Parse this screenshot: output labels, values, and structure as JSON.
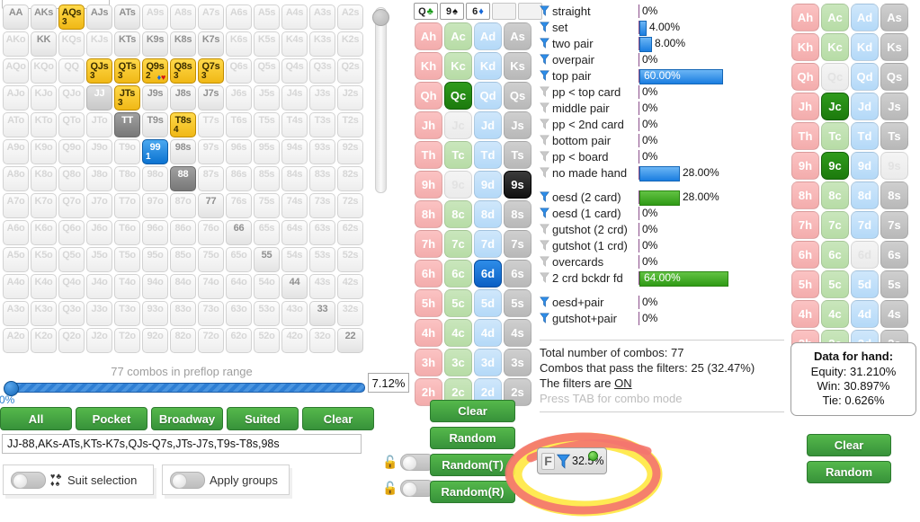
{
  "colors": {
    "accent_green": "#3d9a3d",
    "accent_blue": "#1a7de0",
    "select_yellow": "#f0b816",
    "highlight_red": "#f4746f",
    "highlight_yellow": "#ffe94a"
  },
  "matrix": {
    "rows": [
      [
        {
          "label": "AA",
          "state": "mid"
        },
        {
          "label": "AKs",
          "state": "mid"
        },
        {
          "label": "AQs",
          "state": "sel-y",
          "count": "3"
        },
        {
          "label": "AJs",
          "state": "mid"
        },
        {
          "label": "ATs",
          "state": "mid"
        },
        {
          "label": "A9s",
          "state": "dim"
        },
        {
          "label": "A8s",
          "state": "dim"
        },
        {
          "label": "A7s",
          "state": "dim"
        },
        {
          "label": "A6s",
          "state": "dim"
        },
        {
          "label": "A5s",
          "state": "dim"
        },
        {
          "label": "A4s",
          "state": "dim"
        },
        {
          "label": "A3s",
          "state": "dim"
        },
        {
          "label": "A2s",
          "state": "dim"
        }
      ],
      [
        {
          "label": "AKo",
          "state": "dim"
        },
        {
          "label": "KK",
          "state": "mid"
        },
        {
          "label": "KQs",
          "state": "dim"
        },
        {
          "label": "KJs",
          "state": "dim"
        },
        {
          "label": "KTs",
          "state": "mid"
        },
        {
          "label": "K9s",
          "state": "mid"
        },
        {
          "label": "K8s",
          "state": "mid"
        },
        {
          "label": "K7s",
          "state": "mid"
        },
        {
          "label": "K6s",
          "state": "dim"
        },
        {
          "label": "K5s",
          "state": "dim"
        },
        {
          "label": "K4s",
          "state": "dim"
        },
        {
          "label": "K3s",
          "state": "dim"
        },
        {
          "label": "K2s",
          "state": "dim"
        }
      ],
      [
        {
          "label": "AQo",
          "state": "dim"
        },
        {
          "label": "KQo",
          "state": "dim"
        },
        {
          "label": "QQ",
          "state": "dim"
        },
        {
          "label": "QJs",
          "state": "sel-y",
          "count": "3"
        },
        {
          "label": "QTs",
          "state": "sel-y",
          "count": "3"
        },
        {
          "label": "Q9s",
          "state": "sel-y",
          "count": "2",
          "suits": "♦♥"
        },
        {
          "label": "Q8s",
          "state": "sel-y",
          "count": "3"
        },
        {
          "label": "Q7s",
          "state": "sel-y",
          "count": "3"
        },
        {
          "label": "Q6s",
          "state": "dim"
        },
        {
          "label": "Q5s",
          "state": "dim"
        },
        {
          "label": "Q4s",
          "state": "dim"
        },
        {
          "label": "Q3s",
          "state": "dim"
        },
        {
          "label": "Q2s",
          "state": "dim"
        }
      ],
      [
        {
          "label": "AJo",
          "state": "dim"
        },
        {
          "label": "KJo",
          "state": "dim"
        },
        {
          "label": "QJo",
          "state": "dim"
        },
        {
          "label": "JJ",
          "state": "sel-lg"
        },
        {
          "label": "JTs",
          "state": "sel-y",
          "count": "3"
        },
        {
          "label": "J9s",
          "state": "mid"
        },
        {
          "label": "J8s",
          "state": "mid"
        },
        {
          "label": "J7s",
          "state": "mid"
        },
        {
          "label": "J6s",
          "state": "dim"
        },
        {
          "label": "J5s",
          "state": "dim"
        },
        {
          "label": "J4s",
          "state": "dim"
        },
        {
          "label": "J3s",
          "state": "dim"
        },
        {
          "label": "J2s",
          "state": "dim"
        }
      ],
      [
        {
          "label": "ATo",
          "state": "dim"
        },
        {
          "label": "KTo",
          "state": "dim"
        },
        {
          "label": "QTo",
          "state": "dim"
        },
        {
          "label": "JTo",
          "state": "dim"
        },
        {
          "label": "TT",
          "state": "sel-dg"
        },
        {
          "label": "T9s",
          "state": "mid"
        },
        {
          "label": "T8s",
          "state": "sel-y",
          "count": "4"
        },
        {
          "label": "T7s",
          "state": "dim"
        },
        {
          "label": "T6s",
          "state": "dim"
        },
        {
          "label": "T5s",
          "state": "dim"
        },
        {
          "label": "T4s",
          "state": "dim"
        },
        {
          "label": "T3s",
          "state": "dim"
        },
        {
          "label": "T2s",
          "state": "dim"
        }
      ],
      [
        {
          "label": "A9o",
          "state": "dim"
        },
        {
          "label": "K9o",
          "state": "dim"
        },
        {
          "label": "Q9o",
          "state": "dim"
        },
        {
          "label": "J9o",
          "state": "dim"
        },
        {
          "label": "T9o",
          "state": "dim"
        },
        {
          "label": "99",
          "state": "sel-b",
          "count": "1"
        },
        {
          "label": "98s",
          "state": "mid"
        },
        {
          "label": "97s",
          "state": "dim"
        },
        {
          "label": "96s",
          "state": "dim"
        },
        {
          "label": "95s",
          "state": "dim"
        },
        {
          "label": "94s",
          "state": "dim"
        },
        {
          "label": "93s",
          "state": "dim"
        },
        {
          "label": "92s",
          "state": "dim"
        }
      ],
      [
        {
          "label": "A8o",
          "state": "dim"
        },
        {
          "label": "K8o",
          "state": "dim"
        },
        {
          "label": "Q8o",
          "state": "dim"
        },
        {
          "label": "J8o",
          "state": "dim"
        },
        {
          "label": "T8o",
          "state": "dim"
        },
        {
          "label": "98o",
          "state": "dim"
        },
        {
          "label": "88",
          "state": "sel-dg"
        },
        {
          "label": "87s",
          "state": "dim"
        },
        {
          "label": "86s",
          "state": "dim"
        },
        {
          "label": "85s",
          "state": "dim"
        },
        {
          "label": "84s",
          "state": "dim"
        },
        {
          "label": "83s",
          "state": "dim"
        },
        {
          "label": "82s",
          "state": "dim"
        }
      ],
      [
        {
          "label": "A7o",
          "state": "dim"
        },
        {
          "label": "K7o",
          "state": "dim"
        },
        {
          "label": "Q7o",
          "state": "dim"
        },
        {
          "label": "J7o",
          "state": "dim"
        },
        {
          "label": "T7o",
          "state": "dim"
        },
        {
          "label": "97o",
          "state": "dim"
        },
        {
          "label": "87o",
          "state": "dim"
        },
        {
          "label": "77",
          "state": "mid"
        },
        {
          "label": "76s",
          "state": "dim"
        },
        {
          "label": "75s",
          "state": "dim"
        },
        {
          "label": "74s",
          "state": "dim"
        },
        {
          "label": "73s",
          "state": "dim"
        },
        {
          "label": "72s",
          "state": "dim"
        }
      ],
      [
        {
          "label": "A6o",
          "state": "dim"
        },
        {
          "label": "K6o",
          "state": "dim"
        },
        {
          "label": "Q6o",
          "state": "dim"
        },
        {
          "label": "J6o",
          "state": "dim"
        },
        {
          "label": "T6o",
          "state": "dim"
        },
        {
          "label": "96o",
          "state": "dim"
        },
        {
          "label": "86o",
          "state": "dim"
        },
        {
          "label": "76o",
          "state": "dim"
        },
        {
          "label": "66",
          "state": "mid"
        },
        {
          "label": "65s",
          "state": "dim"
        },
        {
          "label": "64s",
          "state": "dim"
        },
        {
          "label": "63s",
          "state": "dim"
        },
        {
          "label": "62s",
          "state": "dim"
        }
      ],
      [
        {
          "label": "A5o",
          "state": "dim"
        },
        {
          "label": "K5o",
          "state": "dim"
        },
        {
          "label": "Q5o",
          "state": "dim"
        },
        {
          "label": "J5o",
          "state": "dim"
        },
        {
          "label": "T5o",
          "state": "dim"
        },
        {
          "label": "95o",
          "state": "dim"
        },
        {
          "label": "85o",
          "state": "dim"
        },
        {
          "label": "75o",
          "state": "dim"
        },
        {
          "label": "65o",
          "state": "dim"
        },
        {
          "label": "55",
          "state": "mid"
        },
        {
          "label": "54s",
          "state": "dim"
        },
        {
          "label": "53s",
          "state": "dim"
        },
        {
          "label": "52s",
          "state": "dim"
        }
      ],
      [
        {
          "label": "A4o",
          "state": "dim"
        },
        {
          "label": "K4o",
          "state": "dim"
        },
        {
          "label": "Q4o",
          "state": "dim"
        },
        {
          "label": "J4o",
          "state": "dim"
        },
        {
          "label": "T4o",
          "state": "dim"
        },
        {
          "label": "94o",
          "state": "dim"
        },
        {
          "label": "84o",
          "state": "dim"
        },
        {
          "label": "74o",
          "state": "dim"
        },
        {
          "label": "64o",
          "state": "dim"
        },
        {
          "label": "54o",
          "state": "dim"
        },
        {
          "label": "44",
          "state": "mid"
        },
        {
          "label": "43s",
          "state": "dim"
        },
        {
          "label": "42s",
          "state": "dim"
        }
      ],
      [
        {
          "label": "A3o",
          "state": "dim"
        },
        {
          "label": "K3o",
          "state": "dim"
        },
        {
          "label": "Q3o",
          "state": "dim"
        },
        {
          "label": "J3o",
          "state": "dim"
        },
        {
          "label": "T3o",
          "state": "dim"
        },
        {
          "label": "93o",
          "state": "dim"
        },
        {
          "label": "83o",
          "state": "dim"
        },
        {
          "label": "73o",
          "state": "dim"
        },
        {
          "label": "63o",
          "state": "dim"
        },
        {
          "label": "53o",
          "state": "dim"
        },
        {
          "label": "43o",
          "state": "dim"
        },
        {
          "label": "33",
          "state": "mid"
        },
        {
          "label": "32s",
          "state": "dim"
        }
      ],
      [
        {
          "label": "A2o",
          "state": "dim"
        },
        {
          "label": "K2o",
          "state": "dim"
        },
        {
          "label": "Q2o",
          "state": "dim"
        },
        {
          "label": "J2o",
          "state": "dim"
        },
        {
          "label": "T2o",
          "state": "dim"
        },
        {
          "label": "92o",
          "state": "dim"
        },
        {
          "label": "82o",
          "state": "dim"
        },
        {
          "label": "72o",
          "state": "dim"
        },
        {
          "label": "62o",
          "state": "dim"
        },
        {
          "label": "52o",
          "state": "dim"
        },
        {
          "label": "42o",
          "state": "dim"
        },
        {
          "label": "32o",
          "state": "dim"
        },
        {
          "label": "22",
          "state": "mid"
        }
      ]
    ]
  },
  "range_slider": {
    "combos_label": "77 combos in preflop range",
    "min_label": "0%",
    "percent_value": "7.12%"
  },
  "range_buttons": [
    {
      "label": "All"
    },
    {
      "label": "Pocket"
    },
    {
      "label": "Broadway"
    },
    {
      "label": "Suited"
    },
    {
      "label": "Clear"
    }
  ],
  "range_text": "JJ-88,AKs-ATs,KTs-K7s,QJs-Q7s,JTs-J7s,T9s-T8s,98s",
  "toggles": [
    {
      "label": "Suit selection",
      "on": false
    },
    {
      "label": "Apply groups",
      "on": false
    }
  ],
  "board": {
    "slots": [
      {
        "rank": "Q",
        "suit": "♣",
        "suit_class": "suit-c",
        "filled": true
      },
      {
        "rank": "9",
        "suit": "♠",
        "suit_class": "suit-s",
        "filled": true
      },
      {
        "rank": "6",
        "suit": "♦",
        "suit_class": "suit-d",
        "filled": true
      },
      {
        "rank": "",
        "suit": "",
        "suit_class": "",
        "filled": false
      },
      {
        "rank": "",
        "suit": "",
        "suit_class": "",
        "filled": false
      }
    ]
  },
  "card_grid_ranks": [
    "A",
    "K",
    "Q",
    "J",
    "T",
    "9",
    "8",
    "7",
    "6",
    "5",
    "4",
    "3",
    "2"
  ],
  "card_grid_suits": [
    "h",
    "c",
    "d",
    "s"
  ],
  "mid_grid": {
    "selected": {
      "Qc": "pick-green",
      "9s": "pick-black",
      "6d": "pick-blue"
    },
    "disabled": [
      "Jc",
      "9c"
    ]
  },
  "right_grid": {
    "selected": {
      "Jc": "pick-green",
      "9c": "pick-green"
    },
    "disabled": [
      "Qc",
      "6d",
      "9s"
    ]
  },
  "filters": {
    "made_hands": [
      {
        "label": "straight",
        "value": "0%",
        "pct": 0,
        "active": true,
        "color": "blue"
      },
      {
        "label": "set",
        "value": "4.00%",
        "pct": 4,
        "active": true,
        "color": "blue"
      },
      {
        "label": "two pair",
        "value": "8.00%",
        "pct": 8,
        "active": true,
        "color": "blue"
      },
      {
        "label": "overpair",
        "value": "0%",
        "pct": 0,
        "active": true,
        "color": "blue"
      },
      {
        "label": "top pair",
        "value": "60.00%",
        "pct": 60,
        "active": true,
        "color": "blue",
        "inside": true
      },
      {
        "label": "pp < top card",
        "value": "0%",
        "pct": 0,
        "active": false,
        "color": "blue"
      },
      {
        "label": "middle pair",
        "value": "0%",
        "pct": 0,
        "active": false,
        "color": "blue"
      },
      {
        "label": "pp < 2nd card",
        "value": "0%",
        "pct": 0,
        "active": false,
        "color": "blue"
      },
      {
        "label": "bottom pair",
        "value": "0%",
        "pct": 0,
        "active": false,
        "color": "blue"
      },
      {
        "label": "pp < board",
        "value": "0%",
        "pct": 0,
        "active": false,
        "color": "blue"
      },
      {
        "label": "no made hand",
        "value": "28.00%",
        "pct": 28,
        "active": false,
        "color": "blue"
      }
    ],
    "draws": [
      {
        "label": "oesd (2 card)",
        "value": "28.00%",
        "pct": 28,
        "active": true,
        "color": "green"
      },
      {
        "label": "oesd (1 card)",
        "value": "0%",
        "pct": 0,
        "active": true,
        "color": "green"
      },
      {
        "label": "gutshot (2 crd)",
        "value": "0%",
        "pct": 0,
        "active": false,
        "color": "green"
      },
      {
        "label": "gutshot (1 crd)",
        "value": "0%",
        "pct": 0,
        "active": false,
        "color": "green"
      },
      {
        "label": "overcards",
        "value": "0%",
        "pct": 0,
        "active": false,
        "color": "green"
      },
      {
        "label": "2 crd bckdr fd",
        "value": "64.00%",
        "pct": 64,
        "active": false,
        "color": "green",
        "inside": true
      }
    ],
    "combo_draws": [
      {
        "label": "oesd+pair",
        "value": "0%",
        "pct": 0,
        "active": true,
        "color": "blue"
      },
      {
        "label": "gutshot+pair",
        "value": "0%",
        "pct": 0,
        "active": true,
        "color": "blue"
      }
    ]
  },
  "info": {
    "total_combos": "Total number of combos: 77",
    "passing": "Combos that pass the filters: 25 (32.47%)",
    "filters_prefix": "The filters are ",
    "filters_state": "ON",
    "hint": "Press TAB for combo mode"
  },
  "hand_data": {
    "title": "Data for hand:",
    "equity": "Equity: 31.210%",
    "win": "Win: 30.897%",
    "tie": "Tie: 0.626%"
  },
  "mid_buttons": [
    {
      "label": "Clear"
    },
    {
      "label": "Random"
    },
    {
      "label": "Random(T)"
    },
    {
      "label": "Random(R)"
    }
  ],
  "right_buttons": [
    {
      "label": "Clear"
    },
    {
      "label": "Random"
    }
  ],
  "filter_widget": {
    "icon_letter": "F",
    "percent": "32.5%"
  }
}
